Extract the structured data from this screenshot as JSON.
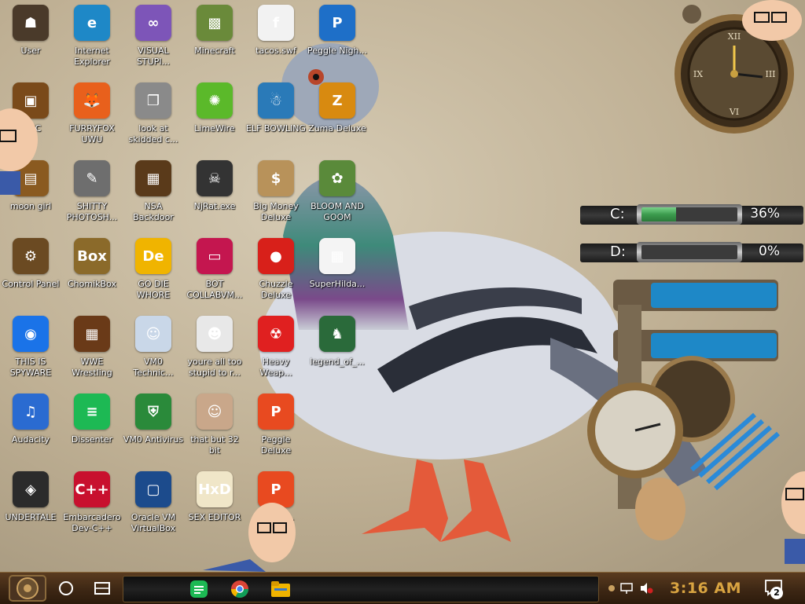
{
  "desktop": {
    "columns": [
      [
        {
          "label": "User",
          "icon": "steampunk-user-icon",
          "color": "#4a3a2a",
          "glyph": "☗"
        },
        {
          "label": "is PC",
          "icon": "this-pc-icon",
          "color": "#7a4a1a",
          "glyph": "▣"
        },
        {
          "label": "moon girl",
          "icon": "folder-icon",
          "color": "#8a5a20",
          "glyph": "▤"
        },
        {
          "label": "Control Panel",
          "icon": "control-panel-icon",
          "color": "#6b4a22",
          "glyph": "⚙"
        },
        {
          "label": "THIS IS SPYWARE",
          "icon": "chrome-icon",
          "color": "#1a73e8",
          "glyph": "◉"
        },
        {
          "label": "Audacity",
          "icon": "audacity-icon",
          "color": "#2a6bd1",
          "glyph": "♫"
        },
        {
          "label": "UNDERTALE",
          "icon": "unity-icon",
          "color": "#2b2b2b",
          "glyph": "◈"
        }
      ],
      [
        {
          "label": "Internet Explorer",
          "icon": "edge-icon",
          "color": "#1e88c7",
          "glyph": "e"
        },
        {
          "label": "FURRYFOX UWU",
          "icon": "firefox-icon",
          "color": "#e8601c",
          "glyph": "🦊"
        },
        {
          "label": "SHITTY PHOTOSH...",
          "icon": "gimp-icon",
          "color": "#6e6e6e",
          "glyph": "✎"
        },
        {
          "label": "ChomikBox",
          "icon": "chomikbox-icon",
          "color": "#8b6a2a",
          "glyph": "Box"
        },
        {
          "label": "WWE Wrestling",
          "icon": "wrestling-icon",
          "color": "#6a3a18",
          "glyph": "▦"
        },
        {
          "label": "Dissenter",
          "icon": "dissenter-icon",
          "color": "#1db954",
          "glyph": "≡"
        },
        {
          "label": "Embarcadero Dev-C++",
          "icon": "devcpp-icon",
          "color": "#c8102e",
          "glyph": "C++"
        }
      ],
      [
        {
          "label": "VISUAL STUPI...",
          "icon": "visual-studio-icon",
          "color": "#7d55b8",
          "glyph": "∞"
        },
        {
          "label": "look at skidded c...",
          "icon": "window-stack-icon",
          "color": "#8a8a8a",
          "glyph": "❐"
        },
        {
          "label": "NSA Backdoor",
          "icon": "nsa-backdoor-icon",
          "color": "#5a3a1a",
          "glyph": "▦"
        },
        {
          "label": "GO DIE WHORE",
          "icon": "die-icon",
          "color": "#f0b400",
          "glyph": "De"
        },
        {
          "label": "VM0 Technic...",
          "icon": "technician-icon",
          "color": "#c9d7e8",
          "glyph": "☺"
        },
        {
          "label": "VM0 Antivirus",
          "icon": "shield-icon",
          "color": "#2a8a3a",
          "glyph": "⛨"
        },
        {
          "label": "Oracle VM VirtualBox",
          "icon": "virtualbox-icon",
          "color": "#1c4b8c",
          "glyph": "▢"
        }
      ],
      [
        {
          "label": "Minecraft",
          "icon": "minecraft-icon",
          "color": "#6a8a3a",
          "glyph": "▩"
        },
        {
          "label": "LimeWire",
          "icon": "limewire-icon",
          "color": "#5bb92a",
          "glyph": "✺"
        },
        {
          "label": "NjRat.exe",
          "icon": "skull-icon",
          "color": "#333333",
          "glyph": "☠"
        },
        {
          "label": "BOT COLLABVM...",
          "icon": "monitor-icon",
          "color": "#c4164f",
          "glyph": "▭"
        },
        {
          "label": "youre all too stupid to r...",
          "icon": "portrait-icon",
          "color": "#e8e8e8",
          "glyph": "☻"
        },
        {
          "label": "that but 32 bit",
          "icon": "portrait-icon",
          "color": "#c9a78a",
          "glyph": "☺"
        },
        {
          "label": "SEX EDITOR",
          "icon": "hxd-icon",
          "color": "#f0e6c8",
          "glyph": "HxD"
        }
      ],
      [
        {
          "label": "tacos.swf",
          "icon": "flash-file-icon",
          "color": "#f2f2f2",
          "glyph": "f"
        },
        {
          "label": "ELF BOWLING",
          "icon": "elf-bowling-icon",
          "color": "#2a7ab8",
          "glyph": "☃"
        },
        {
          "label": "Big Money Deluxe",
          "icon": "money-bag-icon",
          "color": "#b8925a",
          "glyph": "$"
        },
        {
          "label": "Chuzzle Deluxe",
          "icon": "chuzzle-icon",
          "color": "#d8201a",
          "glyph": "●"
        },
        {
          "label": "Heavy Weap...",
          "icon": "radiation-icon",
          "color": "#e02020",
          "glyph": "☢"
        },
        {
          "label": "Peggle Deluxe",
          "icon": "peggle-icon",
          "color": "#e84a20",
          "glyph": "P"
        },
        {
          "label": "P...ld d...",
          "icon": "peggle-icon",
          "color": "#e84a20",
          "glyph": "P"
        }
      ],
      [
        {
          "label": "Peggle Nigh...",
          "icon": "peggle-nights-icon",
          "color": "#1e6fc8",
          "glyph": "P"
        },
        {
          "label": "Zuma Deluxe",
          "icon": "zuma-icon",
          "color": "#d88a10",
          "glyph": "Z"
        },
        {
          "label": "BLOOM AND GOOM",
          "icon": "flower-icon",
          "color": "#5a8a3a",
          "glyph": "✿"
        },
        {
          "label": "SuperHilda...",
          "icon": "pixel-cat-icon",
          "color": "#f4f4f4",
          "glyph": "▦"
        },
        {
          "label": "legend_of_...",
          "icon": "pixel-hero-icon",
          "color": "#2a6a3a",
          "glyph": "♞"
        }
      ]
    ]
  },
  "drives": [
    {
      "letter": "C:",
      "percent": 36,
      "text": "36%"
    },
    {
      "letter": "D:",
      "percent": 0,
      "text": "0%"
    }
  ],
  "taskbar": {
    "time": "3:16 AM",
    "notification_count": "2",
    "pinned": [
      {
        "name": "dissenter-taskbar-icon",
        "color": "#1db954"
      },
      {
        "name": "chrome-taskbar-icon",
        "color": "#1a73e8"
      },
      {
        "name": "file-explorer-icon",
        "color": "#f0b400"
      }
    ]
  },
  "colors": {
    "taskbar_bg": "#3d2714",
    "clock_text": "#d9a441",
    "meter_fill": "#3c9c4e"
  }
}
